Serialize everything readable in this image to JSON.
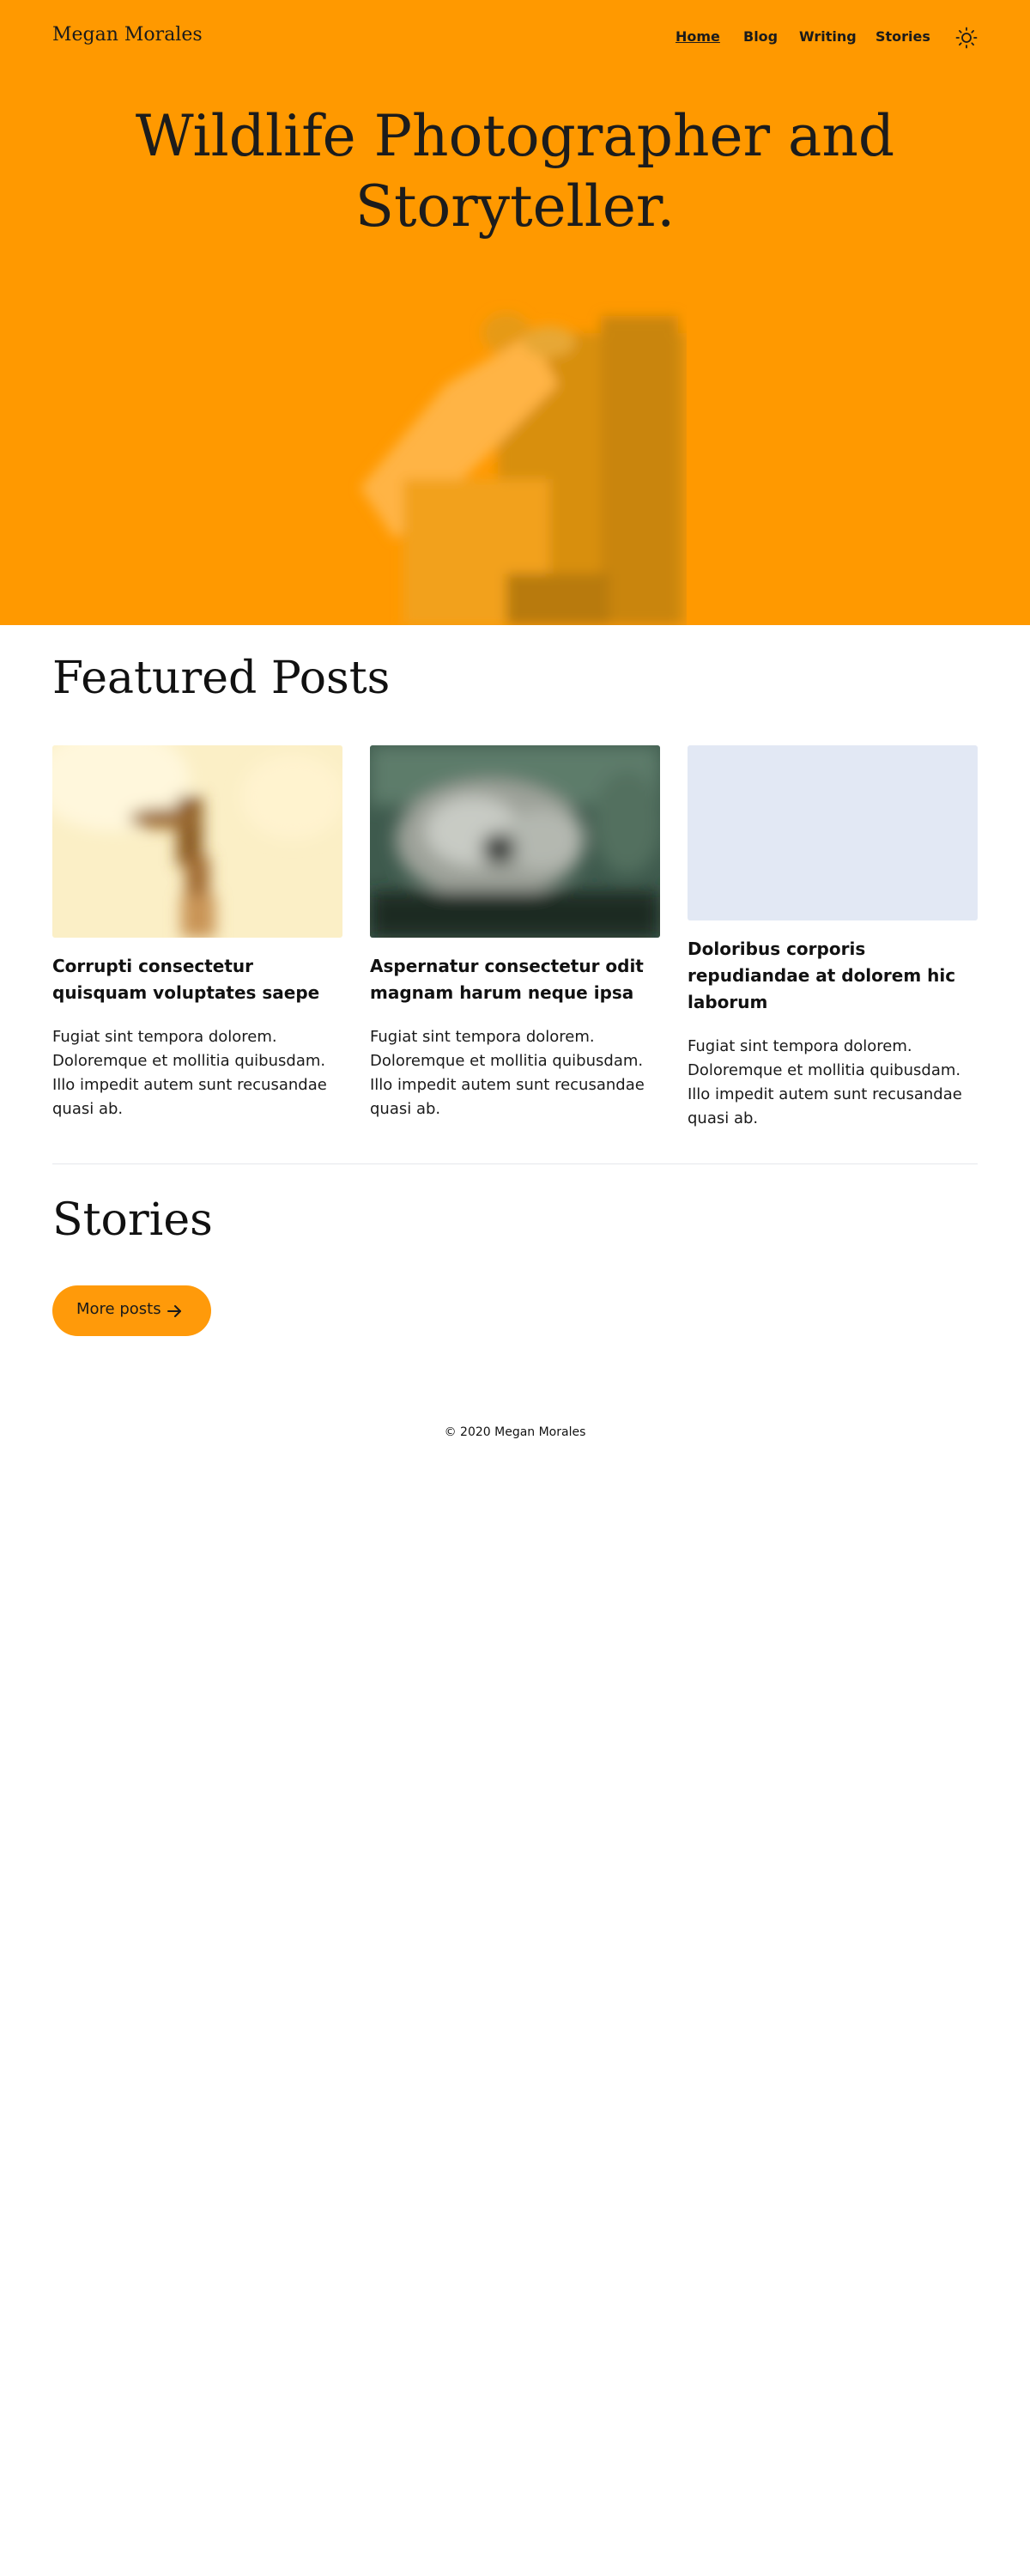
{
  "header": {
    "site_name": "Megan Morales",
    "nav": [
      {
        "label": "Home",
        "active": true
      },
      {
        "label": "Blog",
        "active": false
      },
      {
        "label": "Writing",
        "active": false
      },
      {
        "label": "Stories",
        "active": false
      }
    ],
    "theme_toggle_icon": "sun-icon"
  },
  "hero": {
    "title_line1": "Wildlife Photographer and",
    "title_line2": "Storyteller.",
    "background_color": "#ff9900"
  },
  "featured": {
    "heading": "Featured Posts",
    "posts": [
      {
        "title": "Corrupti consectetur quisquam voluptates saepe",
        "excerpt": "Fugiat sint tempora dolorem. Doloremque et mollitia quibusdam. Illo impedit autem sunt recusandae quasi ab."
      },
      {
        "title": "Aspernatur consectetur odit magnam harum neque ipsa",
        "excerpt": "Fugiat sint tempora dolorem. Doloremque et mollitia quibusdam. Illo impedit autem sunt recusandae quasi ab."
      },
      {
        "title": "Doloribus corporis repudiandae at dolorem hic laborum",
        "excerpt": "Fugiat sint tempora dolorem. Doloremque et mollitia quibusdam. Illo impedit autem sunt recusandae quasi ab."
      }
    ]
  },
  "stories": {
    "heading": "Stories",
    "more_button": "More posts",
    "more_button_icon": "arrow-right-icon"
  },
  "footer": {
    "copyright": "© 2020 Megan Morales"
  }
}
